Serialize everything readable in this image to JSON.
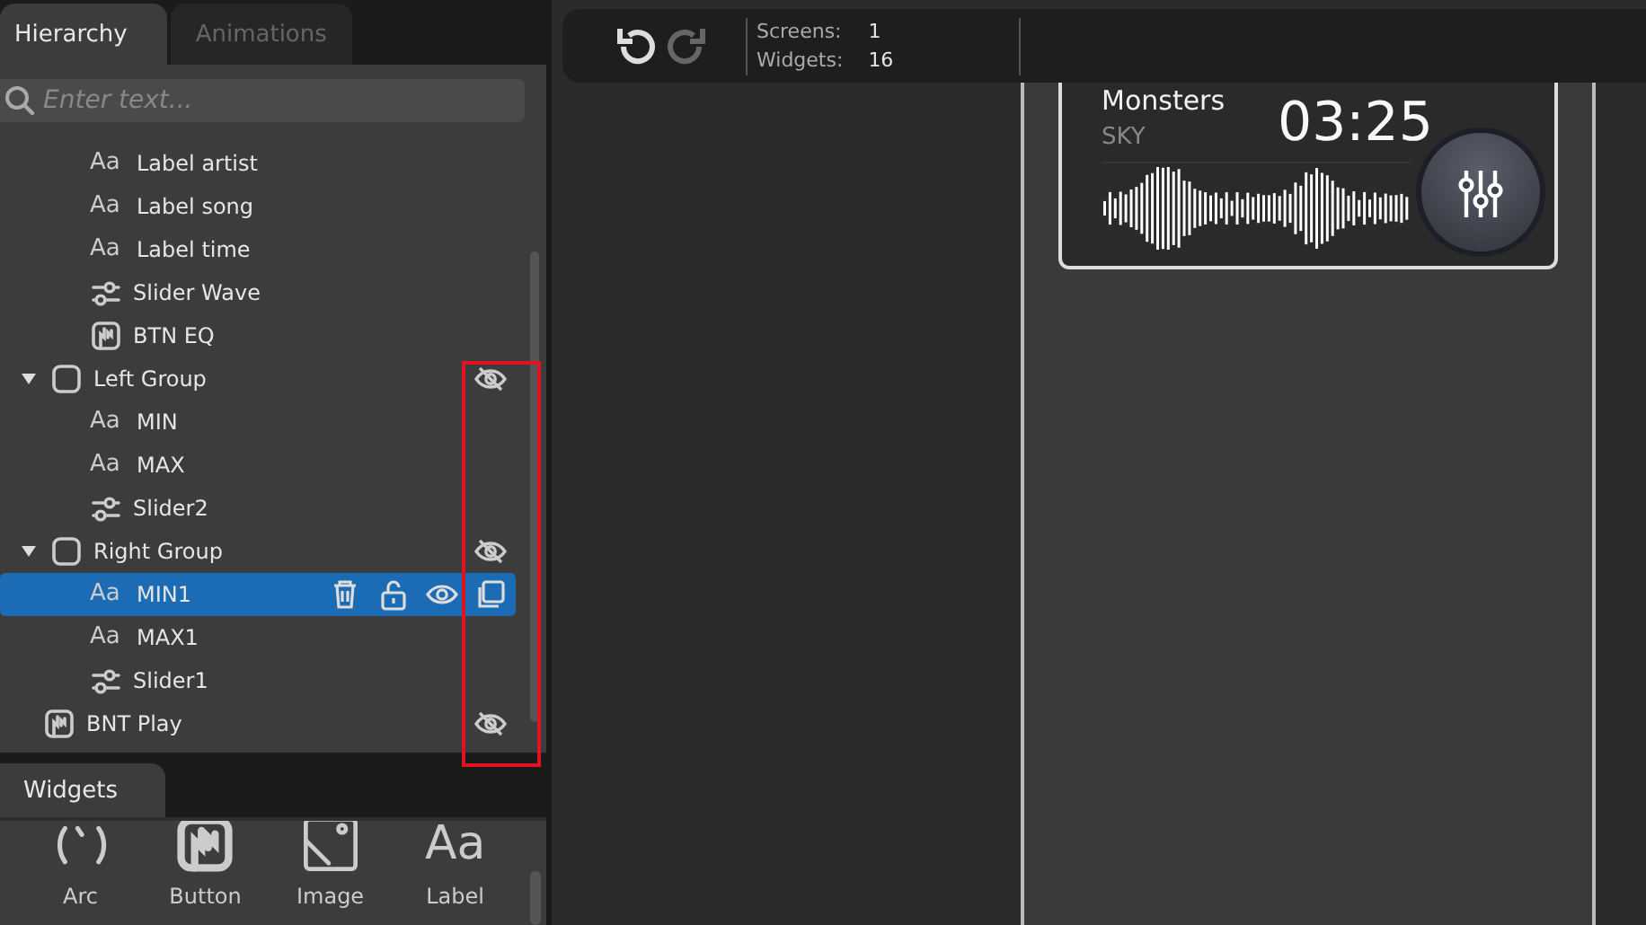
{
  "hierarchy_tabs": [
    {
      "label": "Hierarchy",
      "selected": true
    },
    {
      "label": "Animations",
      "selected": false
    }
  ],
  "search": {
    "placeholder": "Enter text..."
  },
  "tree": {
    "continued_children": [
      {
        "label": "Label artist",
        "kind": "label",
        "icon_text": "Aa",
        "selected": false,
        "hidden": false
      },
      {
        "label": "Label song",
        "kind": "label",
        "icon_text": "Aa",
        "selected": false,
        "hidden": false
      },
      {
        "label": "Label time",
        "kind": "label",
        "icon_text": "Aa",
        "selected": false,
        "hidden": false
      },
      {
        "label": "Slider Wave",
        "kind": "slider",
        "selected": false,
        "hidden": false
      },
      {
        "label": "BTN EQ",
        "kind": "button",
        "selected": false,
        "hidden": false
      }
    ],
    "items": [
      {
        "label": "Left Group",
        "kind": "group",
        "selected": false,
        "hidden": true,
        "expanded": true,
        "children": [
          {
            "label": "MIN",
            "kind": "label",
            "icon_text": "Aa",
            "selected": false,
            "hidden": false
          },
          {
            "label": "MAX",
            "kind": "label",
            "icon_text": "Aa",
            "selected": false,
            "hidden": false
          },
          {
            "label": "Slider2",
            "kind": "slider",
            "selected": false,
            "hidden": false
          }
        ]
      },
      {
        "label": "Right Group",
        "kind": "group",
        "selected": false,
        "hidden": true,
        "expanded": true,
        "children": [
          {
            "label": "MIN1",
            "kind": "label",
            "icon_text": "Aa",
            "selected": true,
            "hidden": false
          },
          {
            "label": "MAX1",
            "kind": "label",
            "icon_text": "Aa",
            "selected": false,
            "hidden": false
          },
          {
            "label": "Slider1",
            "kind": "slider",
            "selected": false,
            "hidden": false
          }
        ]
      },
      {
        "label": "BNT Play",
        "kind": "button",
        "selected": false,
        "hidden": true
      }
    ]
  },
  "widgets_tab": {
    "label": "Widgets"
  },
  "widgets": [
    {
      "label": "Arc",
      "kind": "arc"
    },
    {
      "label": "Button",
      "kind": "button"
    },
    {
      "label": "Image",
      "kind": "image"
    },
    {
      "label": "Label",
      "kind": "label",
      "icon_text": "Aa"
    }
  ],
  "toolbar": {
    "stats": [
      {
        "label": "Screens:",
        "value": "1"
      },
      {
        "label": "Widgets:",
        "value": "16"
      }
    ]
  },
  "preview": {
    "song": "Monsters",
    "artist": "SKY",
    "time": "03:25"
  }
}
